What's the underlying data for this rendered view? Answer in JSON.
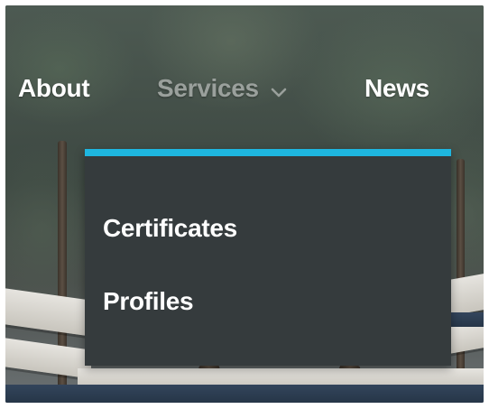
{
  "nav": {
    "items": [
      {
        "label": "About",
        "active": false
      },
      {
        "label": "Services",
        "active": true,
        "icon": "chevron-down-icon"
      },
      {
        "label": "News",
        "active": false
      }
    ]
  },
  "dropdown": {
    "accent_color": "#1eb6e0",
    "background_color": "#353b3d",
    "items": [
      {
        "label": "Certificates"
      },
      {
        "label": "Profiles"
      }
    ]
  }
}
